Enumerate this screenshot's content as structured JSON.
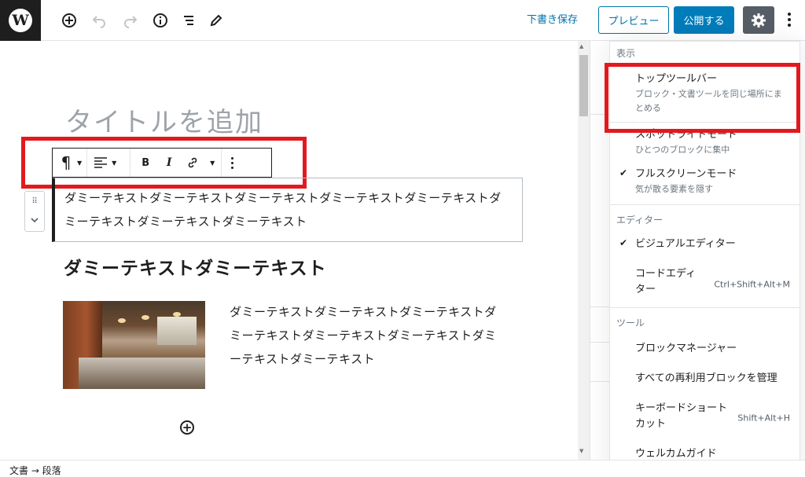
{
  "topbar": {
    "draft_save": "下書き保存",
    "preview": "プレビュー",
    "publish": "公開する",
    "logo_letter": "W"
  },
  "editor": {
    "title_placeholder": "タイトルを追加",
    "paragraph": "ダミーテキストダミーテキストダミーテキストダミーテキストダミーテキストダミーテキストダミーテキストダミーテキスト",
    "heading": "ダミーテキストダミーテキスト",
    "media_text": "ダミーテキストダミーテキストダミーテキストダミーテキストダミーテキストダミーテキストダミーテキストダミーテキスト"
  },
  "block_toolbar": {
    "paragraph_glyph": "¶",
    "bold": "B",
    "italic": "I"
  },
  "menu": {
    "groups": [
      {
        "label": "表示",
        "items": [
          {
            "label": "トップツールバー",
            "desc": "ブロック・文書ツールを同じ場所にまとめる",
            "checked": false
          },
          {
            "label": "スポットライトモード",
            "desc": "ひとつのブロックに集中",
            "checked": false
          },
          {
            "label": "フルスクリーンモード",
            "desc": "気が散る要素を隠す",
            "checked": true
          }
        ]
      },
      {
        "label": "エディター",
        "items": [
          {
            "label": "ビジュアルエディター",
            "checked": true
          },
          {
            "label": "コードエディター",
            "shortcut": "Ctrl+Shift+Alt+M",
            "checked": false
          }
        ]
      },
      {
        "label": "ツール",
        "items": [
          {
            "label": "ブロックマネージャー"
          },
          {
            "label": "すべての再利用ブロックを管理"
          },
          {
            "label": "キーボードショートカット",
            "shortcut": "Shift+Alt+H"
          },
          {
            "label": "ウェルカムガイド"
          }
        ]
      }
    ]
  },
  "status_bar": {
    "breadcrumb": "文書 → 段落"
  },
  "colors": {
    "accent": "#007cba",
    "link": "#0073aa",
    "highlight_box": "#e2191f",
    "settings_bg": "#555d66"
  }
}
